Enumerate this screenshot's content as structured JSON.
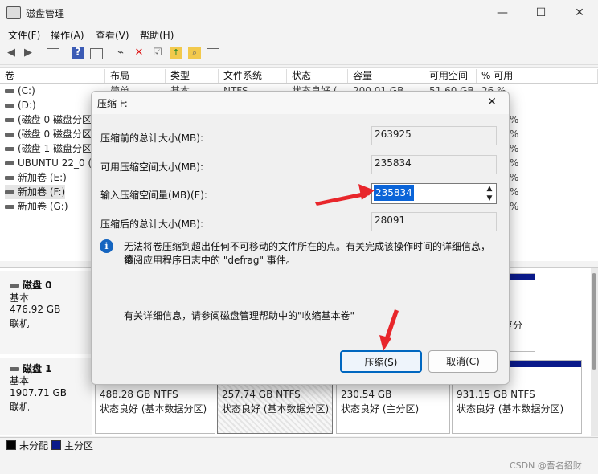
{
  "window": {
    "title": "磁盘管理",
    "minimize": "—",
    "maximize": "☐",
    "close": "✕"
  },
  "menu": [
    "文件(F)",
    "操作(A)",
    "查看(V)",
    "帮助(H)"
  ],
  "columns": [
    "卷",
    "布局",
    "类型",
    "文件系统",
    "状态",
    "容量",
    "可用空间",
    "% 可用"
  ],
  "volumes": [
    "(C:)",
    "(D:)",
    "(磁盘 0 磁盘分区",
    "(磁盘 0 磁盘分区",
    "(磁盘 1 磁盘分区",
    "UBUNTU 22_0 (/",
    "新加卷 (E:)",
    "新加卷 (F:)",
    "新加卷 (G:)"
  ],
  "row1_partial": {
    "layout": "简单",
    "type": "基本",
    "fs": "NTFS",
    "status": "状态良好 (",
    "capacity": "200.01 GB",
    "free": "51.60 GB",
    "pct": "26 %"
  },
  "right_partial": [
    "%",
    "%",
    "%",
    "%",
    "%",
    "%",
    "%"
  ],
  "disks": [
    {
      "name": "磁盘 0",
      "type": "基本",
      "size": "476.92 GB",
      "state": "联机"
    },
    {
      "name": "磁盘 1",
      "type": "基本",
      "size": "1907.71 GB",
      "state": "联机"
    }
  ],
  "disk0_right": "复分",
  "disk1_parts": [
    {
      "size": "488.28 GB NTFS",
      "status": "状态良好 (基本数据分区)"
    },
    {
      "size": "257.74 GB NTFS",
      "status": "状态良好 (基本数据分区)"
    },
    {
      "size": "230.54 GB",
      "status": "状态良好 (主分区)"
    },
    {
      "size": "931.15 GB NTFS",
      "status": "状态良好 (基本数据分区)"
    }
  ],
  "legend": {
    "unallocated": "未分配",
    "primary": "主分区",
    "unallocated_color": "#000000",
    "primary_color": "#0a1a8a"
  },
  "dialog": {
    "title": "压缩 F:",
    "close": "✕",
    "total_before_label": "压缩前的总计大小(MB):",
    "total_before_value": "263925",
    "available_label": "可用压缩空间大小(MB):",
    "available_value": "235834",
    "input_label": "输入压缩空间量(MB)(E):",
    "input_value": "235834",
    "total_after_label": "压缩后的总计大小(MB):",
    "total_after_value": "28091",
    "info_line1": "无法将卷压缩到超出任何不可移动的文件所在的点。有关完成该操作时间的详细信息，请",
    "info_line2": "参阅应用程序日志中的 \"defrag\" 事件。",
    "help_text": "有关详细信息，请参阅磁盘管理帮助中的\"收缩基本卷\"",
    "shrink_button": "压缩(S)",
    "cancel_button": "取消(C)",
    "spin_up": "▲",
    "spin_down": "▼",
    "info_icon": "i"
  },
  "watermark": "CSDN @吾名招财",
  "accent_color": "#0067c0",
  "annotation_color": "#e8262b"
}
